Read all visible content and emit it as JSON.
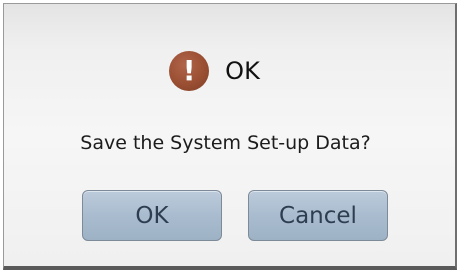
{
  "dialog": {
    "icon": "exclamation-icon",
    "icon_glyph": "!",
    "title": "OK",
    "message": "Save the System Set-up Data?",
    "ok_label": "OK",
    "cancel_label": "Cancel"
  },
  "colors": {
    "icon_fill": "#9a4f33",
    "button_fill": "#a9bccf",
    "button_text": "#2e3e50"
  }
}
